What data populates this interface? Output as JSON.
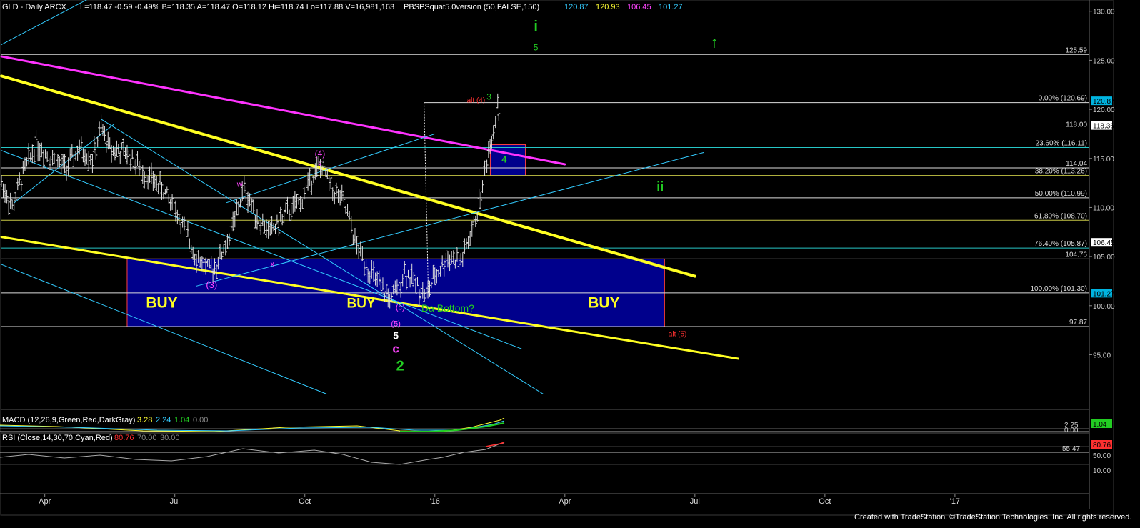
{
  "header": {
    "symbol": "GLD - Daily  ARCX",
    "quote": "L=118.47  -0.59  -0.49%  B=118.35  A=118.47  O=118.12  Hi=118.74  Lo=117.88  V=16,981,163",
    "indicator": "PBSPSquat5.0version (50,FALSE,150)",
    "values": [
      {
        "text": "120.87",
        "color": "#33ccff"
      },
      {
        "text": "120.93",
        "color": "#ffff33"
      },
      {
        "text": "106.45",
        "color": "#ff44ff"
      },
      {
        "text": "101.27",
        "color": "#33ccff"
      }
    ]
  },
  "chart_data": {
    "type": "line",
    "title": "",
    "price_axis": {
      "ylim": [
        89.5,
        131
      ],
      "ticks": [
        95,
        100,
        105,
        110,
        115,
        120,
        125,
        130
      ],
      "tick_labels": [
        "95.00",
        "100.00",
        "105.00",
        "110.00",
        "115.00",
        "120.00",
        "125.00",
        "130.00"
      ]
    },
    "time_axis": {
      "labels": [
        "Apr",
        "Jul",
        "Oct",
        "'16",
        "Apr",
        "Jul",
        "Oct",
        "'17"
      ],
      "positions": [
        1,
        4,
        7,
        10,
        13,
        16,
        19,
        22
      ],
      "xlim": [
        0,
        25.1
      ]
    },
    "price_path": [
      {
        "x": 0.0,
        "y": 112.5
      },
      {
        "x": 0.25,
        "y": 110.0
      },
      {
        "x": 0.5,
        "y": 113.5
      },
      {
        "x": 0.8,
        "y": 116.5
      },
      {
        "x": 1.1,
        "y": 115.2
      },
      {
        "x": 1.5,
        "y": 114.0
      },
      {
        "x": 1.8,
        "y": 116.0
      },
      {
        "x": 2.1,
        "y": 115.0
      },
      {
        "x": 2.3,
        "y": 118.0
      },
      {
        "x": 2.5,
        "y": 116.0
      },
      {
        "x": 2.9,
        "y": 115.5
      },
      {
        "x": 3.3,
        "y": 113.5
      },
      {
        "x": 3.7,
        "y": 112.0
      },
      {
        "x": 4.1,
        "y": 109.0
      },
      {
        "x": 4.5,
        "y": 105.0
      },
      {
        "x": 4.8,
        "y": 103.5
      },
      {
        "x": 5.0,
        "y": 104.5
      },
      {
        "x": 5.3,
        "y": 107.5
      },
      {
        "x": 5.6,
        "y": 112.0
      },
      {
        "x": 5.9,
        "y": 109.0
      },
      {
        "x": 6.2,
        "y": 107.5
      },
      {
        "x": 6.6,
        "y": 109.5
      },
      {
        "x": 6.9,
        "y": 110.5
      },
      {
        "x": 7.2,
        "y": 113.5
      },
      {
        "x": 7.4,
        "y": 114.2
      },
      {
        "x": 7.6,
        "y": 112.0
      },
      {
        "x": 7.9,
        "y": 110.5
      },
      {
        "x": 8.2,
        "y": 106.0
      },
      {
        "x": 8.5,
        "y": 103.5
      },
      {
        "x": 8.8,
        "y": 101.5
      },
      {
        "x": 9.0,
        "y": 100.5
      },
      {
        "x": 9.3,
        "y": 103.5
      },
      {
        "x": 9.6,
        "y": 102.0
      },
      {
        "x": 9.8,
        "y": 101.0
      },
      {
        "x": 10.0,
        "y": 103.0
      },
      {
        "x": 10.3,
        "y": 105.0
      },
      {
        "x": 10.6,
        "y": 104.5
      },
      {
        "x": 10.9,
        "y": 108.0
      },
      {
        "x": 11.1,
        "y": 112.0
      },
      {
        "x": 11.2,
        "y": 115.0
      },
      {
        "x": 11.35,
        "y": 118.0
      },
      {
        "x": 11.45,
        "y": 120.7
      },
      {
        "x": 11.5,
        "y": 118.4
      }
    ],
    "horizontal_levels": [
      {
        "value": 125.59,
        "label": "125.59",
        "color": "#dddddd"
      },
      {
        "value": 120.69,
        "label": "0.00% (120.69)",
        "color": "#dddddd"
      },
      {
        "value": 118.0,
        "label": "118.00",
        "color": "#dddddd"
      },
      {
        "value": 116.11,
        "label": "23.60% (116.11)",
        "color": "#26c6c6"
      },
      {
        "value": 114.04,
        "label": "114.04",
        "color": "#dddddd"
      },
      {
        "value": 113.26,
        "label": "38.20% (113.26)",
        "color": "#c8c846"
      },
      {
        "value": 110.99,
        "label": "50.00% (110.99)",
        "color": "#dddddd"
      },
      {
        "value": 108.7,
        "label": "61.80% (108.70)",
        "color": "#c8c846"
      },
      {
        "value": 105.87,
        "label": "76.40% (105.87)",
        "color": "#26c6c6"
      },
      {
        "value": 104.76,
        "label": "104.76",
        "color": "#dddddd"
      },
      {
        "value": 101.3,
        "label": "100.00% (101.30)",
        "color": "#dddddd"
      },
      {
        "value": 97.87,
        "label": "97.87",
        "color": "#dddddd"
      }
    ],
    "price_flags": [
      {
        "value": 120.87,
        "label": "120.87",
        "bg": "#00b4e0",
        "fg": "#000000"
      },
      {
        "value": 118.36,
        "label": "118.36",
        "bg": "#ffffff",
        "fg": "#000000"
      },
      {
        "value": 106.45,
        "label": "106.45",
        "bg": "#ffffff",
        "fg": "#000000"
      },
      {
        "value": 101.27,
        "label": "101.27",
        "bg": "#00b4e0",
        "fg": "#000000"
      }
    ],
    "trendlines": [
      {
        "x1": 0.0,
        "y1": 125.4,
        "x2": 13.0,
        "y2": 114.4,
        "color": "#ff33ff",
        "width": 3
      },
      {
        "x1": 0.0,
        "y1": 123.4,
        "x2": 16.0,
        "y2": 103.0,
        "color": "#ffff22",
        "width": 4
      },
      {
        "x1": 0.0,
        "y1": 107.0,
        "x2": 17.0,
        "y2": 94.6,
        "color": "#ffff22",
        "width": 3
      },
      {
        "x1": 0.0,
        "y1": 126.6,
        "x2": 3.4,
        "y2": 134.5,
        "color": "#33ccff",
        "width": 1
      },
      {
        "x1": 0.0,
        "y1": 115.8,
        "x2": 12.0,
        "y2": 95.6,
        "color": "#33ccff",
        "width": 1
      },
      {
        "x1": 2.3,
        "y1": 119.0,
        "x2": 12.5,
        "y2": 91.0,
        "color": "#33ccff",
        "width": 1
      },
      {
        "x1": 0.0,
        "y1": 104.2,
        "x2": 7.5,
        "y2": 91.0,
        "color": "#33ccff",
        "width": 1
      },
      {
        "x1": 4.5,
        "y1": 102.0,
        "x2": 16.2,
        "y2": 115.6,
        "color": "#33ccff",
        "width": 1
      },
      {
        "x1": 0.3,
        "y1": 110.5,
        "x2": 2.6,
        "y2": 118.5,
        "color": "#33ccff",
        "width": 1
      },
      {
        "x1": 5.2,
        "y1": 110.5,
        "x2": 10.0,
        "y2": 117.5,
        "color": "#33ccff",
        "width": 1
      }
    ],
    "zones": [
      {
        "x1": 2.9,
        "x2": 15.3,
        "y1": 97.87,
        "y2": 104.76,
        "fill": "#00008c",
        "stroke": "#ff4040"
      },
      {
        "x1": 11.28,
        "x2": 12.09,
        "y1": 113.2,
        "y2": 116.4,
        "fill": "#00008c",
        "stroke": "#ff4040"
      }
    ],
    "annotations": [
      {
        "x": 12.33,
        "y": 128.0,
        "text": "i",
        "color": "#22cc22",
        "size": 20,
        "weight": "bold"
      },
      {
        "x": 12.33,
        "y": 126.0,
        "text": "5",
        "color": "#22cc22",
        "size": 12,
        "weight": "normal"
      },
      {
        "x": 16.45,
        "y": 126.3,
        "text": "↑",
        "color": "#22cc22",
        "size": 22,
        "weight": "bold"
      },
      {
        "x": 10.95,
        "y": 120.7,
        "text": "alt (4)",
        "color": "#ff3030",
        "size": 10,
        "weight": "normal"
      },
      {
        "x": 11.25,
        "y": 121.0,
        "text": "3",
        "color": "#22cc22",
        "size": 12,
        "weight": "normal"
      },
      {
        "x": 11.6,
        "y": 114.6,
        "text": "4",
        "color": "#22cc22",
        "size": 13,
        "weight": "bold"
      },
      {
        "x": 15.2,
        "y": 111.7,
        "text": "ii",
        "color": "#22cc22",
        "size": 18,
        "weight": "bold"
      },
      {
        "x": 7.35,
        "y": 115.2,
        "text": "(4)",
        "color": "#ff44ff",
        "size": 12,
        "weight": "normal"
      },
      {
        "x": 7.35,
        "y": 114.3,
        "text": "v",
        "color": "#ff44ff",
        "size": 11,
        "weight": "normal"
      },
      {
        "x": 5.5,
        "y": 112.1,
        "text": "w",
        "color": "#ff44ff",
        "size": 11,
        "weight": "normal"
      },
      {
        "x": 6.25,
        "y": 104.0,
        "text": "x",
        "color": "#ff44ff",
        "size": 11,
        "weight": "normal"
      },
      {
        "x": 4.85,
        "y": 101.8,
        "text": "(3)",
        "color": "#ff44ff",
        "size": 13,
        "weight": "normal"
      },
      {
        "x": 9.2,
        "y": 99.6,
        "text": "(c)",
        "color": "#ff44ff",
        "size": 11,
        "weight": "normal"
      },
      {
        "x": 10.3,
        "y": 99.4,
        "text": "Da Bottom?",
        "color": "#22cc22",
        "size": 14,
        "weight": "normal"
      },
      {
        "x": 9.1,
        "y": 97.9,
        "text": "(5)",
        "color": "#ff44ff",
        "size": 11,
        "weight": "normal"
      },
      {
        "x": 9.1,
        "y": 96.6,
        "text": "5",
        "color": "#ffffff",
        "size": 14,
        "weight": "bold"
      },
      {
        "x": 9.1,
        "y": 95.2,
        "text": "c",
        "color": "#ff44ff",
        "size": 17,
        "weight": "bold"
      },
      {
        "x": 9.2,
        "y": 93.4,
        "text": "2",
        "color": "#22cc22",
        "size": 20,
        "weight": "bold"
      },
      {
        "x": 3.7,
        "y": 99.8,
        "text": "BUY",
        "color": "#ffff22",
        "size": 21,
        "weight": "bold"
      },
      {
        "x": 8.3,
        "y": 99.8,
        "text": "BUY",
        "color": "#ffff22",
        "size": 19,
        "weight": "bold"
      },
      {
        "x": 13.9,
        "y": 99.8,
        "text": "BUY",
        "color": "#ffff22",
        "size": 21,
        "weight": "bold"
      },
      {
        "x": 15.6,
        "y": 96.9,
        "text": "alt (5)",
        "color": "#ff3030",
        "size": 10,
        "weight": "normal"
      }
    ]
  },
  "macd": {
    "label": "MACD (12,26,9,Green,Red,DarkGray)",
    "values": [
      {
        "text": "3.28",
        "color": "#ffff33"
      },
      {
        "text": "2.24",
        "color": "#33ccff"
      },
      {
        "text": "1.04",
        "color": "#22cc22"
      },
      {
        "text": "0.00",
        "color": "#888888"
      }
    ],
    "axis_right": [
      "2.25",
      "0.00"
    ],
    "flag": "1.04"
  },
  "rsi": {
    "label": "RSI (Close,14,30,70,Cyan,Red)",
    "values": [
      {
        "text": "80.76",
        "color": "#ff3030"
      },
      {
        "text": "70.00",
        "color": "#888888"
      },
      {
        "text": "30.00",
        "color": "#888888"
      }
    ],
    "level_label": "55.47",
    "ticks": [
      "50.00",
      "10.00"
    ],
    "flag": "80.76"
  },
  "footer": {
    "credit": "Created with TradeStation. ©TradeStation Technologies, Inc. All rights reserved."
  }
}
